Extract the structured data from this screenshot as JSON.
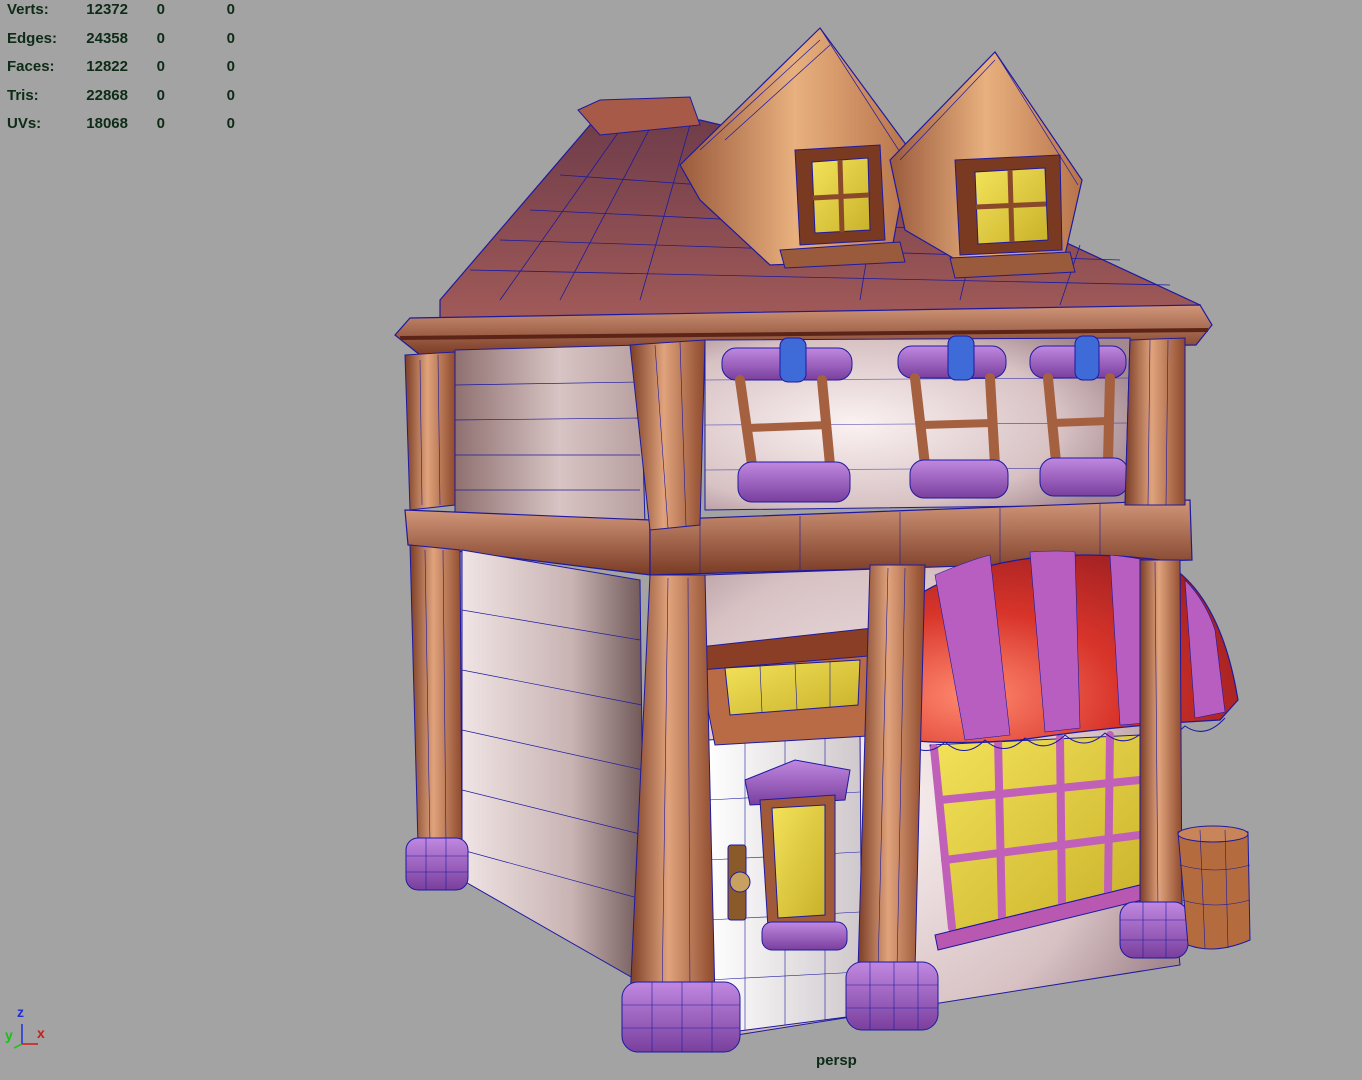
{
  "viewport": {
    "background_color": "#a3a3a3",
    "camera": "persp"
  },
  "heads_up_display": {
    "poly_count": [
      {
        "label": "Verts:",
        "total": "12372",
        "selected": "0",
        "component": "0"
      },
      {
        "label": "Edges:",
        "total": "24358",
        "selected": "0",
        "component": "0"
      },
      {
        "label": "Faces:",
        "total": "12822",
        "selected": "0",
        "component": "0"
      },
      {
        "label": "Tris:",
        "total": "22868",
        "selected": "0",
        "component": "0"
      },
      {
        "label": "UVs:",
        "total": "18068",
        "selected": "0",
        "component": "0"
      }
    ]
  },
  "axis_indicator": {
    "z": "z",
    "y": "y",
    "x": "x",
    "colors": {
      "x": "#d01818",
      "y": "#14c414",
      "z": "#1f2fd8"
    }
  },
  "model": {
    "wireframe_color": "#1e1aa0",
    "colors": {
      "wood_dark": "#7a3a22",
      "wood_light": "#c98a63",
      "wall": "#e4d2d0",
      "purple_trim": "#a460c4",
      "glass": "#e8d437",
      "awning_red": "#d8342a",
      "awning_pink": "#b85ec0",
      "roof": "#8a4a4c"
    }
  }
}
